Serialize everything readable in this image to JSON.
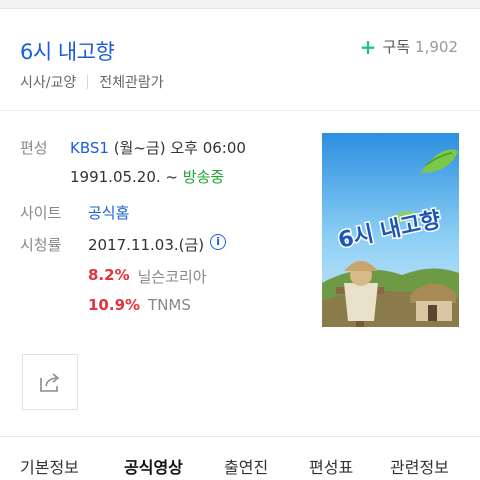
{
  "header": {
    "title": "6시 내고향",
    "subscribe_label": "구독",
    "subscribe_count": "1,902",
    "genre": "시사/교양",
    "rating": "전체관람가"
  },
  "details": {
    "schedule": {
      "label": "편성",
      "channel": "KBS1",
      "time": " (월~금) 오후 06:00",
      "start_date": "1991.05.20. ~ ",
      "status": "방송중"
    },
    "site": {
      "label": "사이트",
      "value": "공식홈"
    },
    "ratings": {
      "label": "시청률",
      "date": "2017.11.03.(금)",
      "info_icon": "i",
      "entries": [
        {
          "value": "8.2%",
          "source": "닐슨코리아"
        },
        {
          "value": "10.9%",
          "source": "TNMS"
        }
      ]
    }
  },
  "poster": {
    "logo_text": "6시 내고향"
  },
  "tabs": [
    "기본정보",
    "공식영상",
    "출연진",
    "편성표",
    "관련정보"
  ],
  "active_tab": "공식영상",
  "colors": {
    "accent": "#1a5fd8",
    "green": "#1fa531",
    "red": "#e6323c",
    "subscribe_plus": "#19c49a"
  }
}
